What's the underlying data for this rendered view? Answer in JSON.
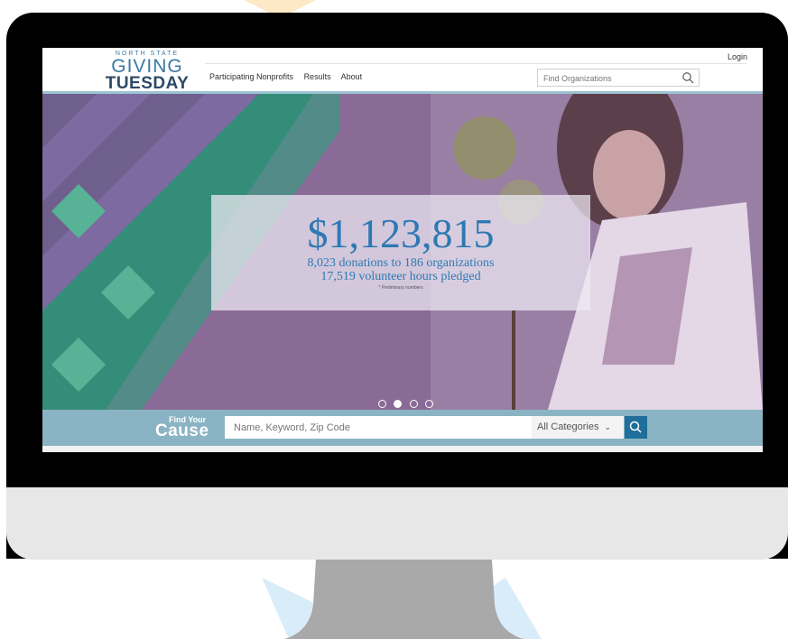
{
  "header": {
    "logo": {
      "top": "NORTH STATE",
      "middle": "GIVING",
      "bottom": "TUESDAY"
    },
    "nav": [
      "Participating Nonprofits",
      "Results",
      "About"
    ],
    "login_label": "Login",
    "search": {
      "placeholder": "Find Organizations",
      "icon": "search-icon"
    }
  },
  "hero": {
    "amount": "$1,123,815",
    "line1": "8,023 donations to 186 organizations",
    "line2": "17,519 volunteer hours pledged",
    "note": "* Preliminary numbers",
    "carousel_dots": 4,
    "active_dot": 2
  },
  "find_cause": {
    "label_small": "Find Your",
    "label_big": "Cause",
    "input_placeholder": "Name, Keyword, Zip Code",
    "category_selected": "All Categories",
    "search_button_icon": "search-icon"
  },
  "colors": {
    "brand_blue": "#2d79b3",
    "find_bar": "#8ab4c3",
    "search_button": "#1f6f9a",
    "monitor_body": "#e7e7e7"
  }
}
